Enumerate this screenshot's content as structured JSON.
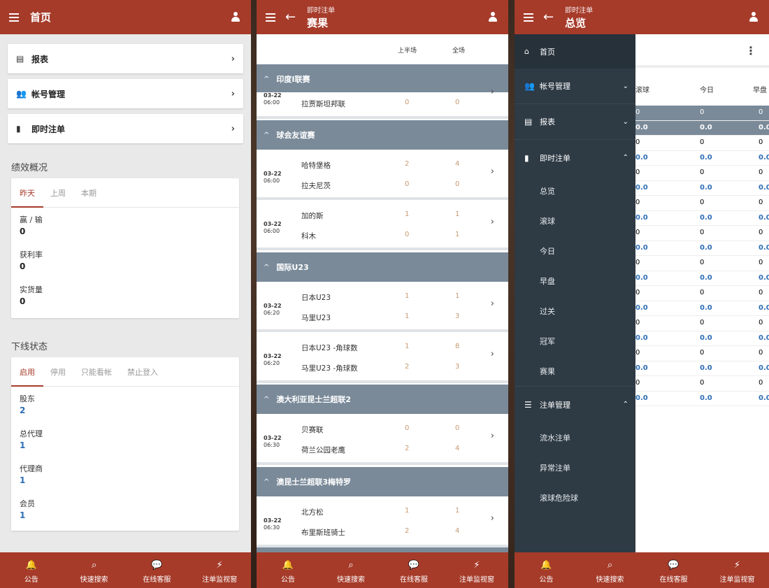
{
  "phone1": {
    "appbar": {
      "title": "首页"
    },
    "menu": [
      {
        "icon": "report-icon",
        "label": "报表"
      },
      {
        "icon": "account-icon",
        "label": "帐号管理"
      },
      {
        "icon": "chart-icon",
        "label": "即时注单"
      }
    ],
    "perf": {
      "title": "绩效概况",
      "tabs": [
        "昨天",
        "上周",
        "本期"
      ],
      "rows": [
        {
          "label": "赢 / 输",
          "value": "0"
        },
        {
          "label": "获利率",
          "value": "0"
        },
        {
          "label": "实货量",
          "value": "0"
        }
      ]
    },
    "downline": {
      "title": "下线状态",
      "tabs": [
        "启用",
        "停用",
        "只能看帐",
        "禁止登入"
      ],
      "rows": [
        {
          "label": "股东",
          "value": "2"
        },
        {
          "label": "总代理",
          "value": "1"
        },
        {
          "label": "代理商",
          "value": "1"
        },
        {
          "label": "会员",
          "value": "1"
        }
      ]
    }
  },
  "phone2": {
    "appbar": {
      "subtitle": "即时注单",
      "title": "赛果"
    },
    "columns": {
      "half": "上半场",
      "full": "全场"
    },
    "leagues": [
      {
        "name": "印度I联赛"
      },
      {
        "name": "球会友谊赛"
      },
      {
        "name": "国际U23"
      },
      {
        "name": "澳大利亚昆士兰超联2"
      },
      {
        "name": "澳昆士兰超联3梅特罗"
      }
    ],
    "matches": [
      {
        "date": "03-22",
        "time": "06:00",
        "home": "",
        "away": "拉贾斯坦邦联",
        "h1": "",
        "h2": "0",
        "f1": "",
        "f2": "0"
      },
      {
        "date": "03-22",
        "time": "06:00",
        "home": "哈特堡格",
        "away": "拉夫尼茨",
        "h1": "2",
        "h2": "0",
        "f1": "4",
        "f2": "0"
      },
      {
        "date": "03-22",
        "time": "06:00",
        "home": "加的斯",
        "away": "科木",
        "h1": "1",
        "h2": "0",
        "f1": "1",
        "f2": "1"
      },
      {
        "date": "03-22",
        "time": "06:20",
        "home": "日本U23",
        "away": "马里U23",
        "h1": "1",
        "h2": "1",
        "f1": "1",
        "f2": "3"
      },
      {
        "date": "03-22",
        "time": "06:20",
        "home": "日本U23 -角球数",
        "away": "马里U23 -角球数",
        "h1": "1",
        "h2": "2",
        "f1": "8",
        "f2": "3"
      },
      {
        "date": "03-22",
        "time": "06:30",
        "home": "贝赛联",
        "away": "荷兰公园老鹰",
        "h1": "0",
        "h2": "2",
        "f1": "0",
        "f2": "4"
      },
      {
        "date": "03-22",
        "time": "06:30",
        "home": "北方松",
        "away": "布里斯班骑士",
        "h1": "1",
        "h2": "2",
        "f1": "1",
        "f2": "4"
      }
    ]
  },
  "phone3": {
    "appbar": {
      "subtitle": "即时注单",
      "title": "总览"
    },
    "drawer": {
      "home": "首页",
      "items": [
        {
          "icon": "account-icon",
          "label": "帐号管理",
          "arrow": "⌄"
        },
        {
          "icon": "report-icon",
          "label": "报表",
          "arrow": "⌄"
        },
        {
          "icon": "chart-icon",
          "label": "即时注单",
          "arrow": "⌃"
        }
      ],
      "sub": [
        "总览",
        "滚球",
        "今日",
        "早盘",
        "过关",
        "冠军",
        "赛果"
      ],
      "manage": {
        "label": "注单管理",
        "arrow": "⌃"
      },
      "manage_sub": [
        "流水注单",
        "异常注单",
        "滚球危险球"
      ]
    },
    "grid": {
      "headers": [
        "滚球",
        "今日",
        "早盘"
      ],
      "rows": [
        {
          "type": "hl",
          "vals": [
            "0",
            "0",
            "0"
          ]
        },
        {
          "type": "hl val",
          "vals": [
            "0.0",
            "0.0",
            "0.0"
          ]
        },
        {
          "type": "",
          "vals": [
            "0",
            "0",
            "0"
          ]
        },
        {
          "type": "val",
          "vals": [
            "0.0",
            "0.0",
            "0.0"
          ]
        },
        {
          "type": "",
          "vals": [
            "0",
            "0",
            "0"
          ]
        },
        {
          "type": "val",
          "vals": [
            "0.0",
            "0.0",
            "0.0"
          ]
        },
        {
          "type": "",
          "vals": [
            "0",
            "0",
            "0"
          ]
        },
        {
          "type": "val",
          "vals": [
            "0.0",
            "0.0",
            "0.0"
          ]
        },
        {
          "type": "",
          "vals": [
            "0",
            "0",
            "0"
          ]
        },
        {
          "type": "val",
          "vals": [
            "0.0",
            "0.0",
            "0.0"
          ]
        },
        {
          "type": "",
          "vals": [
            "0",
            "0",
            "0"
          ]
        },
        {
          "type": "val",
          "vals": [
            "0.0",
            "0.0",
            "0.0"
          ]
        },
        {
          "type": "",
          "vals": [
            "0",
            "0",
            "0"
          ]
        },
        {
          "type": "val",
          "vals": [
            "0.0",
            "0.0",
            "0.0"
          ]
        },
        {
          "type": "",
          "vals": [
            "0",
            "0",
            "0"
          ]
        },
        {
          "type": "val",
          "vals": [
            "0.0",
            "0.0",
            "0.0"
          ]
        },
        {
          "type": "",
          "vals": [
            "0",
            "0",
            "0"
          ]
        },
        {
          "type": "val",
          "vals": [
            "0.0",
            "0.0",
            "0.0"
          ]
        },
        {
          "type": "",
          "vals": [
            "0",
            "0",
            "0"
          ]
        },
        {
          "type": "val",
          "vals": [
            "0.0",
            "0.0",
            "0.0"
          ]
        }
      ]
    }
  },
  "bottomnav": [
    {
      "icon": "bell-icon",
      "glyph": "🔔",
      "label": "公告"
    },
    {
      "icon": "search-icon",
      "glyph": "⌕",
      "label": "快速搜索"
    },
    {
      "icon": "chat-icon",
      "glyph": "💬",
      "label": "在线客服"
    },
    {
      "icon": "lightning-icon",
      "glyph": "⚡",
      "label": "注单监视窗"
    }
  ],
  "colors": {
    "primary": "#a63b2a",
    "league": "#7a8a99",
    "drawer": "#2e3a44",
    "value_blue": "#2d6db5"
  }
}
